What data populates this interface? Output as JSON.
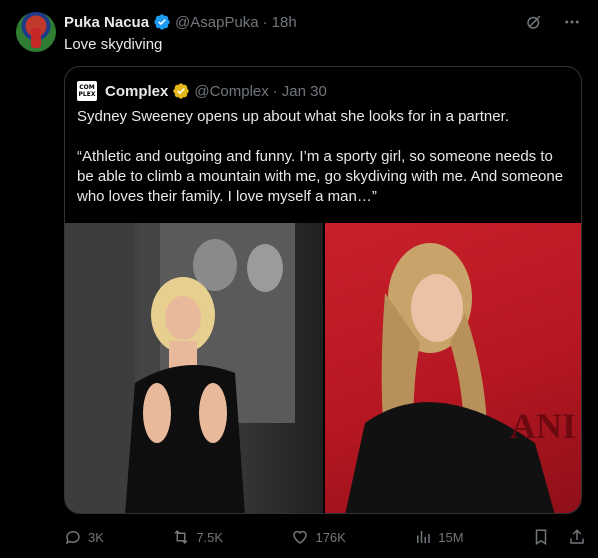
{
  "tweet": {
    "author_name": "Puka Nacua",
    "author_handle": "@AsapPuka",
    "separator": "·",
    "time": "18h",
    "text": "Love skydiving"
  },
  "quote": {
    "logo_text": "COM PLEX",
    "author_name": "Complex",
    "author_handle": "@Complex",
    "separator": "·",
    "date": "Jan 30",
    "line1": "Sydney Sweeney opens up about what she looks for in a partner.",
    "line2": "“Athletic and outgoing and funny. I’m a sporty girl, so someone needs to be able to climb a mountain with me, go skydiving with me. And someone who loves their family. I love myself a man…”"
  },
  "actions": {
    "replies": "3K",
    "reposts": "7.5K",
    "likes": "176K",
    "views": "15M"
  },
  "icons": {
    "verified": "verified-badge-icon",
    "grok": "grok-icon",
    "more": "more-icon",
    "reply": "reply-icon",
    "repost": "repost-icon",
    "like": "heart-icon",
    "views": "views-icon",
    "bookmark": "bookmark-icon",
    "share": "share-icon"
  },
  "colors": {
    "background": "#000000",
    "text": "#e7e9ea",
    "muted": "#71767b",
    "border": "#2f3336",
    "verified_blue": "#1d9bf0",
    "verified_gold": "#e2b719"
  }
}
